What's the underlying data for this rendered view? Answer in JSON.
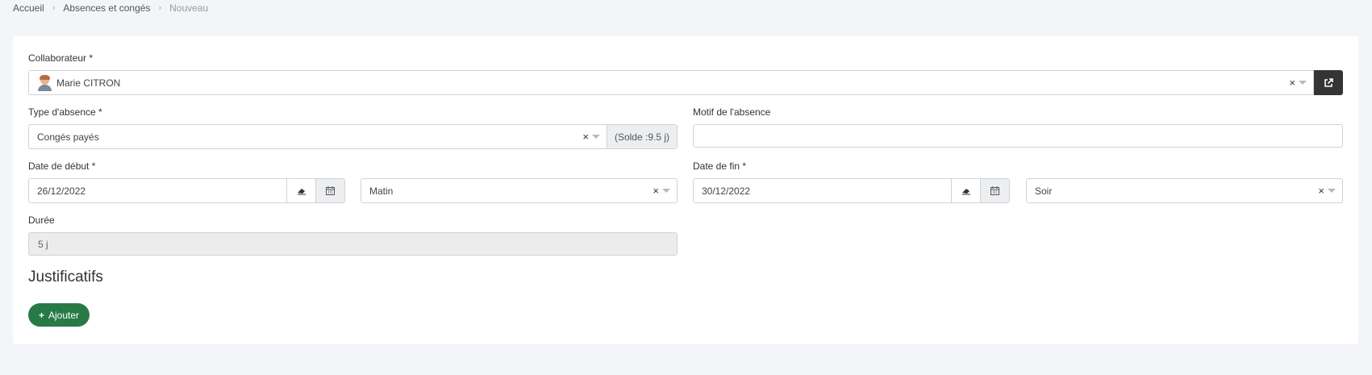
{
  "breadcrumb": {
    "items": [
      "Accueil",
      "Absences et congés"
    ],
    "current": "Nouveau"
  },
  "form": {
    "collaborateur": {
      "label": "Collaborateur *",
      "value": "Marie CITRON",
      "clear": "×"
    },
    "type_absence": {
      "label": "Type d'absence *",
      "value": "Congés payés",
      "clear": "×",
      "solde": "(Solde :9.5 j)"
    },
    "motif": {
      "label": "Motif de l'absence",
      "value": ""
    },
    "date_debut": {
      "label": "Date de début *",
      "value": "26/12/2022",
      "period": "Matin",
      "clear": "×"
    },
    "date_fin": {
      "label": "Date de fin *",
      "value": "30/12/2022",
      "period": "Soir",
      "clear": "×"
    },
    "duree": {
      "label": "Durée",
      "value": "5 j"
    }
  },
  "justificatifs": {
    "title": "Justificatifs",
    "add_label": "Ajouter",
    "add_icon": "+"
  },
  "colors": {
    "accent_green": "#277a46",
    "dark_button": "#343434",
    "background": "#f4f5f9"
  }
}
